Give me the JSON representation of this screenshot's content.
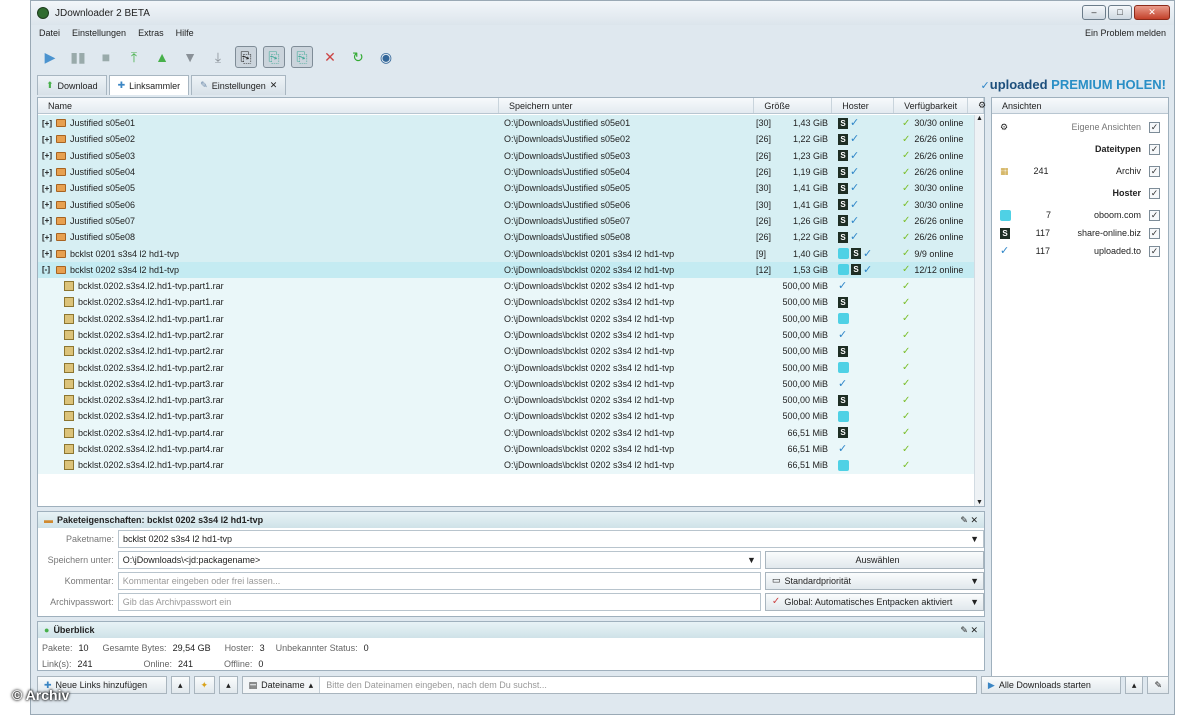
{
  "window": {
    "title": "JDownloader 2 BETA"
  },
  "menu": {
    "items": [
      "Datei",
      "Einstellungen",
      "Extras",
      "Hilfe"
    ],
    "report": "Ein Problem melden"
  },
  "tabs": [
    "Download",
    "Linksammler",
    "Einstellungen"
  ],
  "brand": {
    "name": "uploaded",
    "promo": "PREMIUM HOLEN!"
  },
  "table": {
    "headers": [
      "Name",
      "Speichern unter",
      "Größe",
      "Hoster",
      "Verfügbarkeit"
    ],
    "packages": [
      {
        "name": "Justified s05e01",
        "path": "O:\\jDownloads\\Justified s05e01",
        "count": "[30]",
        "size": "1,43 GiB",
        "avail": "30/30 online"
      },
      {
        "name": "Justified s05e02",
        "path": "O:\\jDownloads\\Justified s05e02",
        "count": "[26]",
        "size": "1,22 GiB",
        "avail": "26/26 online"
      },
      {
        "name": "Justified s05e03",
        "path": "O:\\jDownloads\\Justified s05e03",
        "count": "[26]",
        "size": "1,23 GiB",
        "avail": "26/26 online"
      },
      {
        "name": "Justified s05e04",
        "path": "O:\\jDownloads\\Justified s05e04",
        "count": "[26]",
        "size": "1,19 GiB",
        "avail": "26/26 online"
      },
      {
        "name": "Justified s05e05",
        "path": "O:\\jDownloads\\Justified s05e05",
        "count": "[30]",
        "size": "1,41 GiB",
        "avail": "30/30 online"
      },
      {
        "name": "Justified s05e06",
        "path": "O:\\jDownloads\\Justified s05e06",
        "count": "[30]",
        "size": "1,41 GiB",
        "avail": "30/30 online"
      },
      {
        "name": "Justified s05e07",
        "path": "O:\\jDownloads\\Justified s05e07",
        "count": "[26]",
        "size": "1,26 GiB",
        "avail": "26/26 online"
      },
      {
        "name": "Justified s05e08",
        "path": "O:\\jDownloads\\Justified s05e08",
        "count": "[26]",
        "size": "1,22 GiB",
        "avail": "26/26 online"
      },
      {
        "name": "bcklst 0201 s3s4 l2 hd1-tvp",
        "path": "O:\\jDownloads\\bcklst 0201 s3s4 l2 hd1-tvp",
        "count": "[9]",
        "size": "1,40 GiB",
        "avail": "9/9 online"
      },
      {
        "name": "bcklst 0202 s3s4 l2 hd1-tvp",
        "path": "O:\\jDownloads\\bcklst 0202 s3s4 l2 hd1-tvp",
        "count": "[12]",
        "size": "1,53 GiB",
        "avail": "12/12 online"
      }
    ],
    "files": [
      {
        "name": "bcklst.0202.s3s4.l2.hd1-tvp.part1.rar",
        "size": "500,00 MiB",
        "host": "U"
      },
      {
        "name": "bcklst.0202.s3s4.l2.hd1-tvp.part1.rar",
        "size": "500,00 MiB",
        "host": "S"
      },
      {
        "name": "bcklst.0202.s3s4.l2.hd1-tvp.part1.rar",
        "size": "500,00 MiB",
        "host": "O"
      },
      {
        "name": "bcklst.0202.s3s4.l2.hd1-tvp.part2.rar",
        "size": "500,00 MiB",
        "host": "U"
      },
      {
        "name": "bcklst.0202.s3s4.l2.hd1-tvp.part2.rar",
        "size": "500,00 MiB",
        "host": "S"
      },
      {
        "name": "bcklst.0202.s3s4.l2.hd1-tvp.part2.rar",
        "size": "500,00 MiB",
        "host": "O"
      },
      {
        "name": "bcklst.0202.s3s4.l2.hd1-tvp.part3.rar",
        "size": "500,00 MiB",
        "host": "U"
      },
      {
        "name": "bcklst.0202.s3s4.l2.hd1-tvp.part3.rar",
        "size": "500,00 MiB",
        "host": "S"
      },
      {
        "name": "bcklst.0202.s3s4.l2.hd1-tvp.part3.rar",
        "size": "500,00 MiB",
        "host": "O"
      },
      {
        "name": "bcklst.0202.s3s4.l2.hd1-tvp.part4.rar",
        "size": "66,51 MiB",
        "host": "S"
      },
      {
        "name": "bcklst.0202.s3s4.l2.hd1-tvp.part4.rar",
        "size": "66,51 MiB",
        "host": "U"
      },
      {
        "name": "bcklst.0202.s3s4.l2.hd1-tvp.part4.rar",
        "size": "66,51 MiB",
        "host": "O"
      }
    ],
    "file_path": "O:\\jDownloads\\bcklst 0202 s3s4 l2 hd1-tvp"
  },
  "side": {
    "header": "Ansichten",
    "own_views": "Eigene Ansichten",
    "filetypes_title": "Dateitypen",
    "filetypes": [
      {
        "count": "241",
        "label": "Archiv"
      }
    ],
    "hoster_title": "Hoster",
    "hosters": [
      {
        "count": "7",
        "label": "oboom.com"
      },
      {
        "count": "117",
        "label": "share-online.biz"
      },
      {
        "count": "117",
        "label": "uploaded.to"
      }
    ]
  },
  "props": {
    "title": "Paketeigenschaften: bcklst 0202 s3s4 l2 hd1-tvp",
    "name_label": "Paketname:",
    "name_value": "bcklst 0202 s3s4 l2 hd1-tvp",
    "save_label": "Speichern unter:",
    "save_value": "O:\\jDownloads\\<jd:packagename>",
    "choose": "Auswählen",
    "comment_label": "Kommentar:",
    "comment_placeholder": "Kommentar eingeben oder frei lassen...",
    "priority": "Standardpriorität",
    "pw_label": "Archivpasswort:",
    "pw_placeholder": "Gib das Archivpasswort ein",
    "extract": "Global: Automatisches Entpacken aktiviert"
  },
  "overview": {
    "title": "Überblick",
    "stats": [
      [
        "Pakete:",
        "10"
      ],
      [
        "Gesamte Bytes:",
        "29,54 GB"
      ],
      [
        "Hoster:",
        "3"
      ],
      [
        "Unbekannter Status:",
        "0"
      ]
    ],
    "stats2": [
      [
        "Link(s):",
        "241"
      ],
      [
        "Online:",
        "241"
      ],
      [
        "Offline:",
        "0"
      ]
    ]
  },
  "bottom": {
    "add_links": "Neue Links hinzufügen",
    "filter_label": "Dateiname",
    "search_placeholder": "Bitte den Dateinamen eingeben, nach dem Du suchst...",
    "start_all": "Alle Downloads starten"
  },
  "watermark": "© Archiv"
}
